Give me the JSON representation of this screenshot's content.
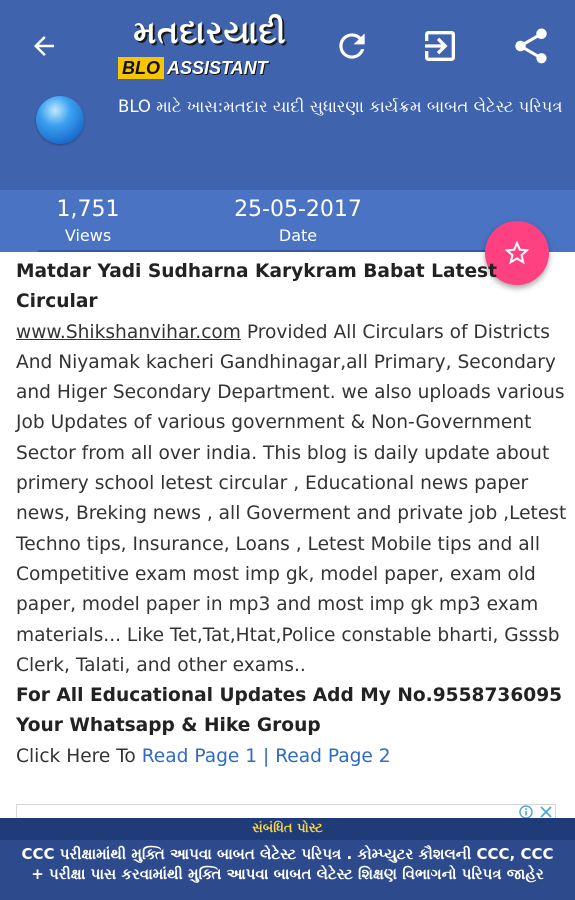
{
  "appbar": {
    "logo_main": "મતદારયાદી",
    "logo_blo": "BLO",
    "logo_assistant": "ASSISTANT",
    "post_title": "BLO માટે ખાસ:મતદાર યાદી સુધારણા કાર્યક્રમ બાબત લેટેસ્ટ પરિપત્ર",
    "icons": [
      "back-arrow-icon",
      "refresh-icon",
      "exit-icon",
      "share-icon"
    ],
    "color": "#3f63ad"
  },
  "stats": {
    "views_value": "1,751",
    "views_label": "Views",
    "date_value": "25-05-2017",
    "date_label": "Date",
    "color": "#4a73c4"
  },
  "fab": {
    "icon": "star-outline-icon",
    "color": "#ff4081"
  },
  "article": {
    "heading": "Matdar Yadi Sudharna Karykram Babat Latest Circular",
    "site_link": "www.Shikshanvihar.com",
    "body": " Provided All Circulars of Districts And Niyamak kacheri Gandhinagar,all Primary, Secondary and Higer Secondary Department. we also uploads various Job Updates of various government & Non-Government Sector from all over india. This blog is daily update about primery school letest circular , Educational news paper news, Breking news , all Goverment and private job ,Letest Techno tips, Insurance, Loans , Letest Mobile tips and all Competitive exam most imp gk, model paper, exam old paper, model paper in mp3 and most imp gk mp3 exam materials... Like Tet,Tat,Htat,Police constable bharti, Gsssb Clerk, Talati, and other exams..",
    "promo": "For All Educational Updates Add My No.9558736095 Your Whatsapp & Hike Group",
    "click_prefix": "Click Here To ",
    "read_page_1": "Read Page 1",
    "separator": " | ",
    "read_page_2": "Read Page 2",
    "link_color": "#2f6bc4"
  },
  "ad": {
    "icons": [
      "ad-info-icon",
      "ad-close-icon"
    ]
  },
  "related": {
    "header": "સંબંધિત પોસ્ટ",
    "text": "CCC પરીક્ષામાંથી મુક્તિ આપવા બાબત લેટેસ્ટ પરિપત્ર . કોમ્પ્યુટર કૌશલની CCC, CCC + પરીક્ષા પાસ કરવામાંથી મુક્તિ આપવા બાબત લેટેસ્ટ શિક્ષણ વિભાગનો પરિપત્ર જાહેર",
    "header_color": "#f4d34a"
  }
}
